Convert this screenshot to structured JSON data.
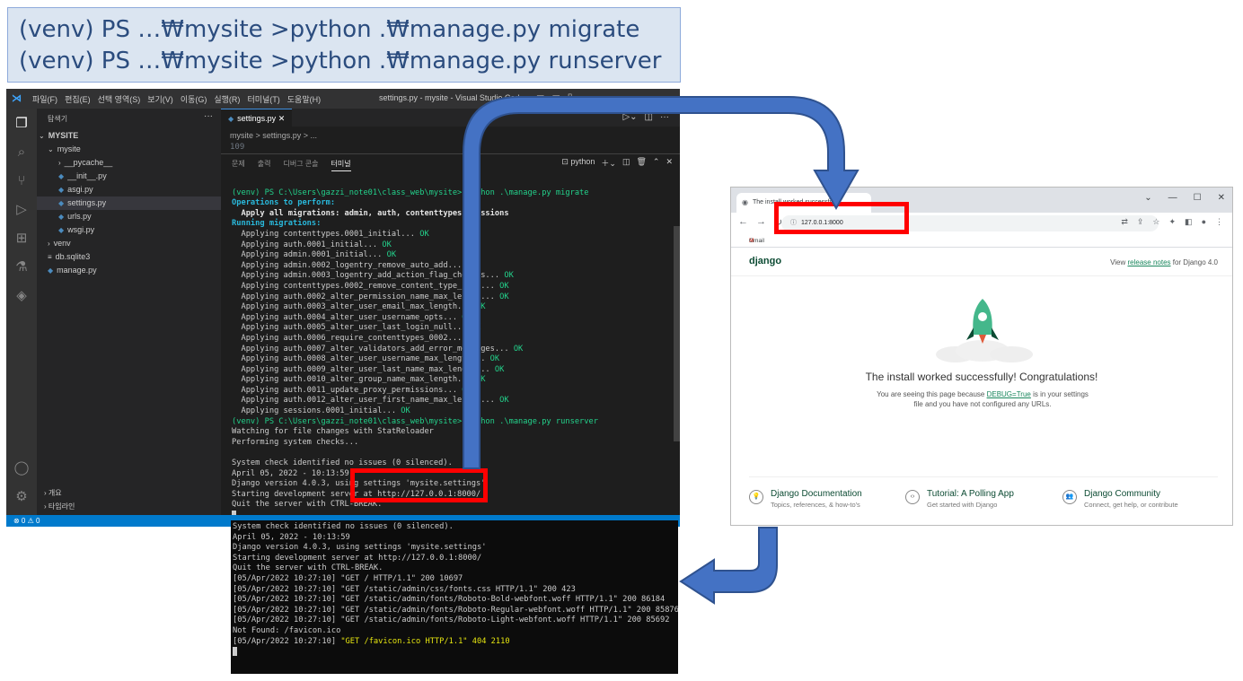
{
  "commands": {
    "line1": "(venv) PS …₩mysite >python .₩manage.py migrate",
    "line2": "(venv) PS …₩mysite >python .₩manage.py runserver"
  },
  "vscode": {
    "menu": [
      "파일(F)",
      "편집(E)",
      "선택 영역(S)",
      "보기(V)",
      "이동(G)",
      "실행(R)",
      "터미널(T)",
      "도움말(H)"
    ],
    "window_title": "settings.py - mysite - Visual Studio Code",
    "explorer_label": "탐색기",
    "project": "MYSITE",
    "tree": [
      "mysite",
      "__pycache__",
      "__init__.py",
      "asgi.py",
      "settings.py",
      "urls.py",
      "wsgi.py",
      "venv",
      "db.sqlite3",
      "manage.py"
    ],
    "outline_label": "개요",
    "timeline_label": "타임라인",
    "tab_label": "settings.py",
    "breadcrumb": "mysite > settings.py > ...",
    "line_number": "109",
    "panel_tabs": [
      "문제",
      "출력",
      "디버그 콘솔",
      "터미널"
    ],
    "terminal_name": "python",
    "status_left": "⊗ 0 ⚠ 0",
    "terminal_lines": [
      "(venv) PS C:\\Users\\gazzi_note01\\class_web\\mysite> python .\\manage.py migrate",
      "Operations to perform:",
      "  Apply all migrations: admin, auth, contenttypes, sessions",
      "Running migrations:",
      "  Applying contenttypes.0001_initial... OK",
      "  Applying auth.0001_initial... OK",
      "  Applying admin.0001_initial... OK",
      "  Applying admin.0002_logentry_remove_auto_add... OK",
      "  Applying admin.0003_logentry_add_action_flag_choices... OK",
      "  Applying contenttypes.0002_remove_content_type_name... OK",
      "  Applying auth.0002_alter_permission_name_max_length... OK",
      "  Applying auth.0003_alter_user_email_max_length... OK",
      "  Applying auth.0004_alter_user_username_opts... OK",
      "  Applying auth.0005_alter_user_last_login_null... OK",
      "  Applying auth.0006_require_contenttypes_0002... OK",
      "  Applying auth.0007_alter_validators_add_error_messages... OK",
      "  Applying auth.0008_alter_user_username_max_length... OK",
      "  Applying auth.0009_alter_user_last_name_max_length... OK",
      "  Applying auth.0010_alter_group_name_max_length... OK",
      "  Applying auth.0011_update_proxy_permissions... OK",
      "  Applying auth.0012_alter_user_first_name_max_length... OK",
      "  Applying sessions.0001_initial... OK",
      "(venv) PS C:\\Users\\gazzi_note01\\class_web\\mysite> python .\\manage.py runserver",
      "Watching for file changes with StatReloader",
      "Performing system checks...",
      "",
      "System check identified no issues (0 silenced).",
      "April 05, 2022 - 10:13:59",
      "Django version 4.0.3, using settings 'mysite.settings'",
      "Starting development server at http://127.0.0.1:8000/",
      "Quit the server with CTRL-BREAK."
    ]
  },
  "server_log": {
    "lines": [
      "System check identified no issues (0 silenced).",
      "April 05, 2022 - 10:13:59",
      "Django version 4.0.3, using settings 'mysite.settings'",
      "Starting development server at http://127.0.0.1:8000/",
      "Quit the server with CTRL-BREAK.",
      "[05/Apr/2022 10:27:10] \"GET / HTTP/1.1\" 200 10697",
      "[05/Apr/2022 10:27:10] \"GET /static/admin/css/fonts.css HTTP/1.1\" 200 423",
      "[05/Apr/2022 10:27:10] \"GET /static/admin/fonts/Roboto-Bold-webfont.woff HTTP/1.1\" 200 86184",
      "[05/Apr/2022 10:27:10] \"GET /static/admin/fonts/Roboto-Regular-webfont.woff HTTP/1.1\" 200 85876",
      "[05/Apr/2022 10:27:10] \"GET /static/admin/fonts/Roboto-Light-webfont.woff HTTP/1.1\" 200 85692",
      "Not Found: /favicon.ico"
    ],
    "error_prefix": "[05/Apr/2022 10:27:10] ",
    "error_text": "\"GET /favicon.ico HTTP/1.1\" 404 2110"
  },
  "browser": {
    "tab_title": "The install worked successfully!",
    "url": "127.0.0.1:8000",
    "bookmark": "Gmail",
    "logo": "django",
    "version_prefix": "View ",
    "version_link": "release notes",
    "version_suffix": " for Django 4.0",
    "congrats": "The install worked successfully! Congratulations!",
    "sub_1": "You are seeing this page because ",
    "sub_link": "DEBUG=True",
    "sub_2": " is in your settings file and you have not configured any URLs.",
    "footer": [
      {
        "title": "Django Documentation",
        "desc": "Topics, references, & how-to's"
      },
      {
        "title": "Tutorial: A Polling App",
        "desc": "Get started with Django"
      },
      {
        "title": "Django Community",
        "desc": "Connect, get help, or contribute"
      }
    ]
  },
  "colors": {
    "arrow": "#4472c4",
    "highlight": "#ff0000",
    "django_green": "#0c4b33",
    "rocket": "#44b78b"
  }
}
